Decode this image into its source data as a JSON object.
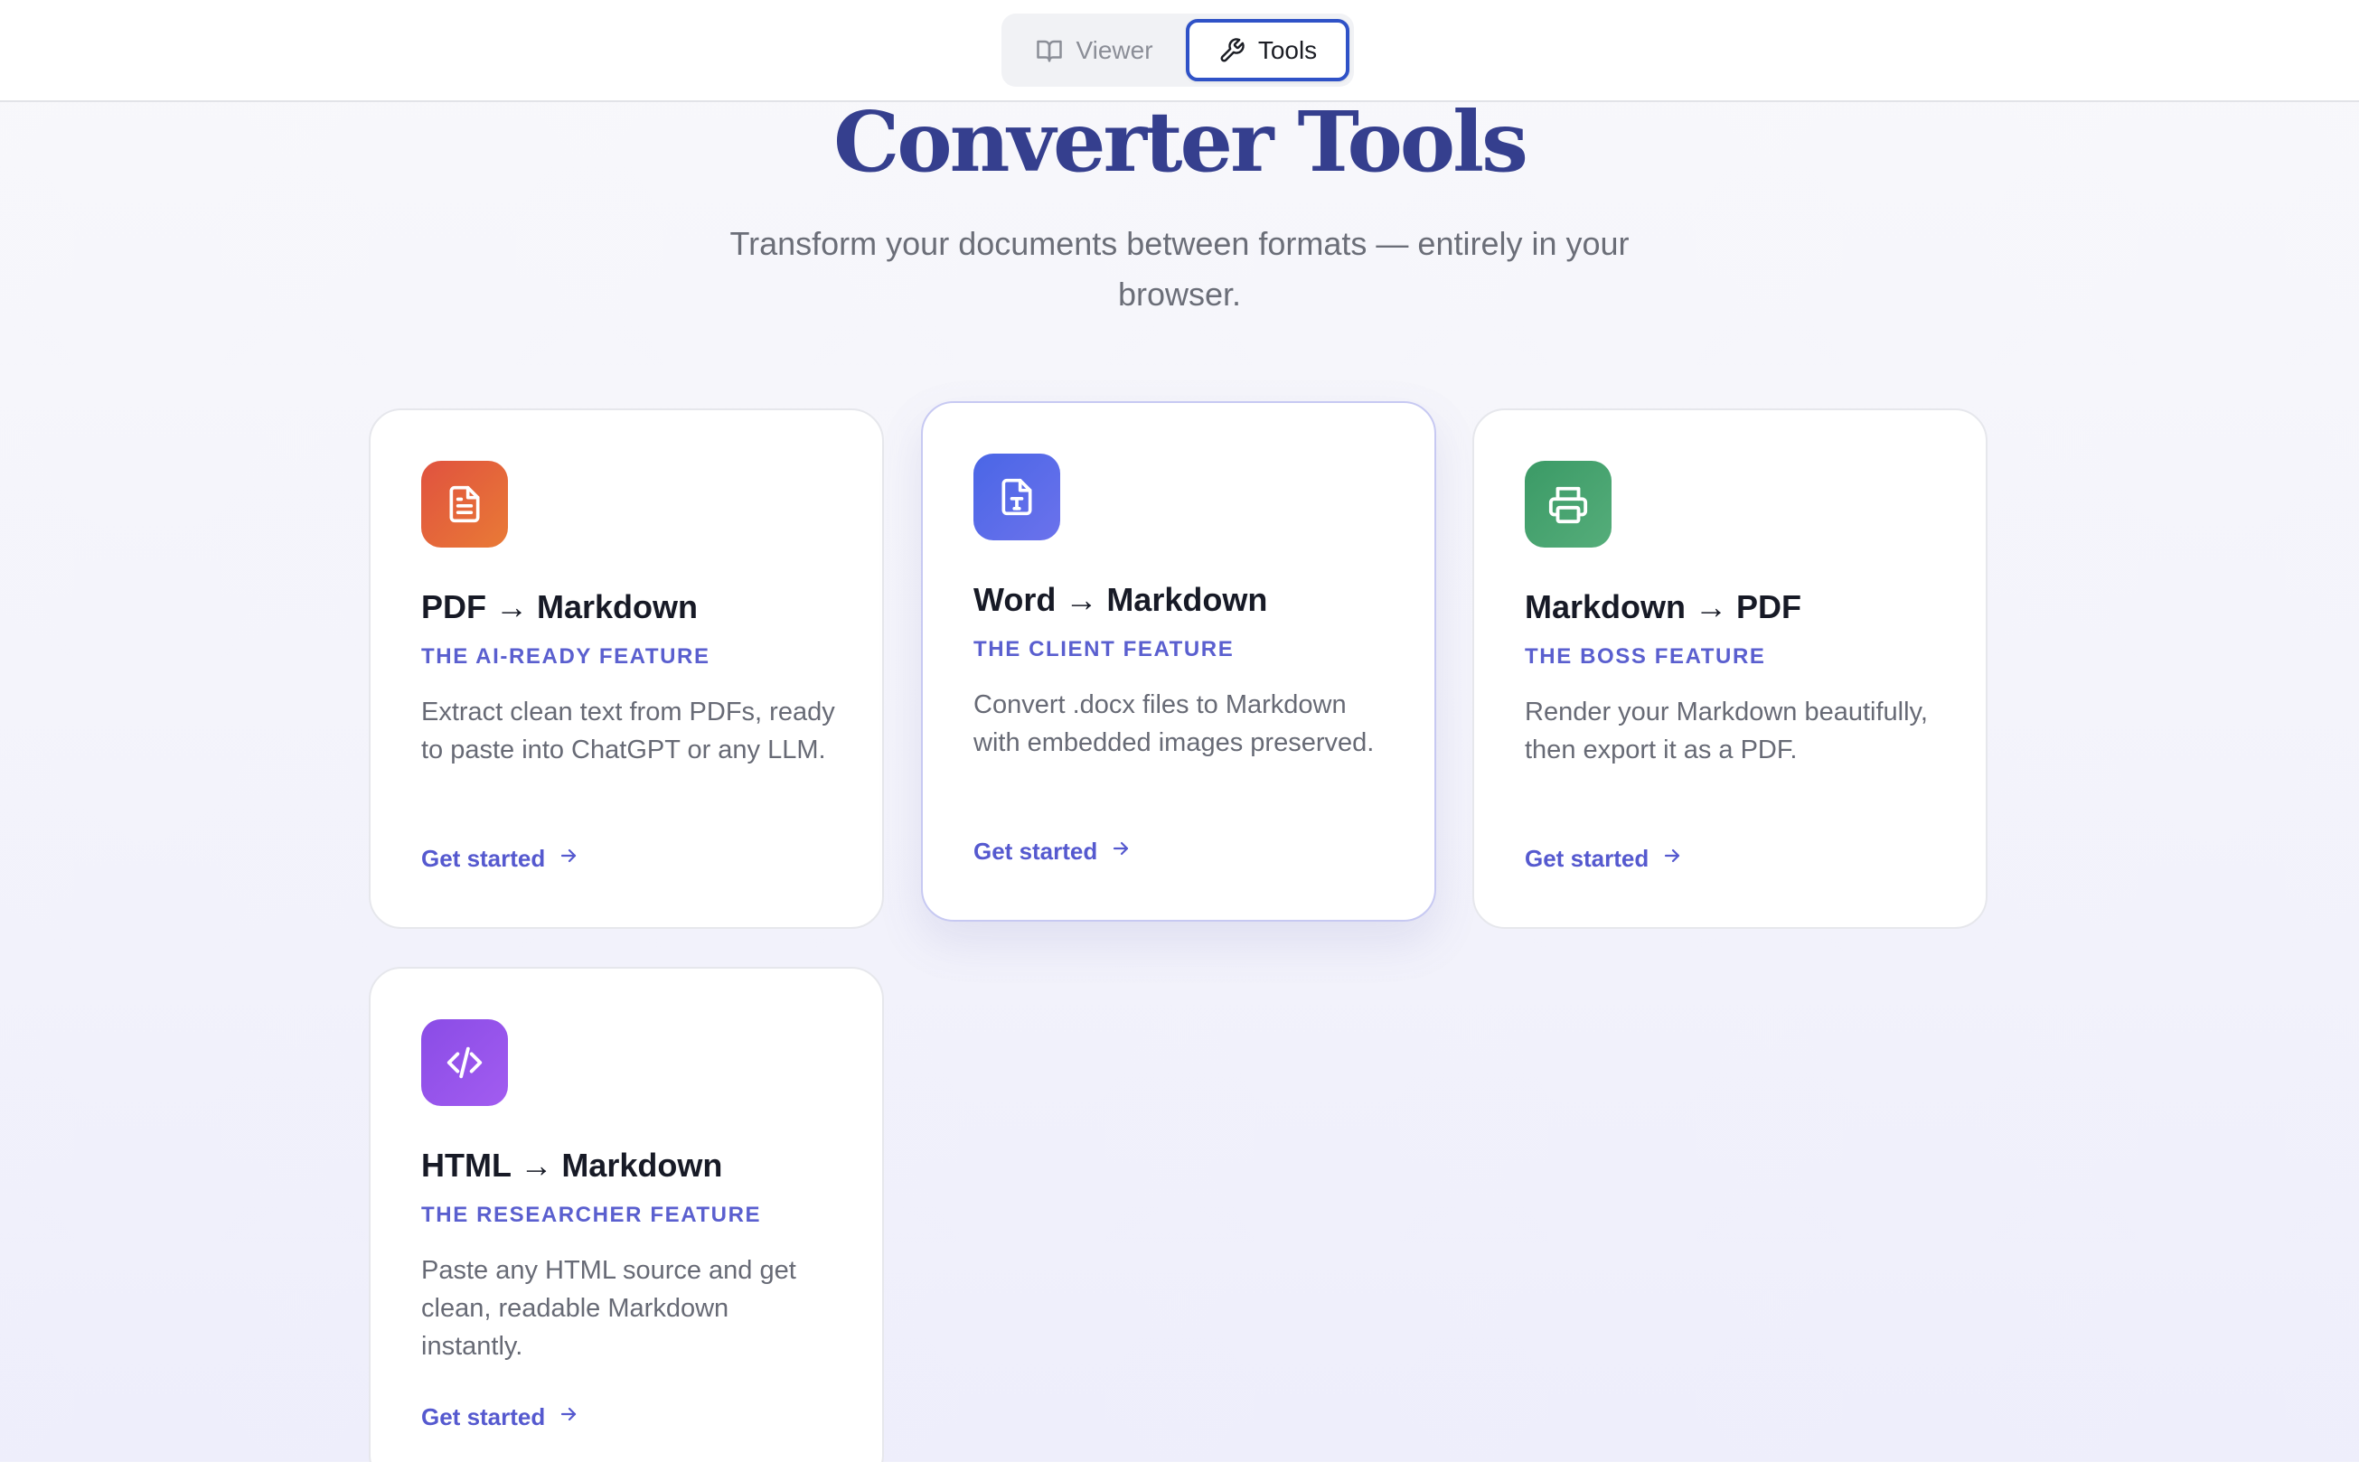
{
  "nav": {
    "viewer_label": "Viewer",
    "tools_label": "Tools",
    "active_tab": "Tools"
  },
  "header": {
    "title": "Converter Tools",
    "subtitle": "Transform your documents between formats — entirely in your browser."
  },
  "cards": [
    {
      "title": "PDF → Markdown",
      "tag": "THE AI-READY FEATURE",
      "description": "Extract clean text from PDFs, ready to paste into ChatGPT or any LLM.",
      "link": "Get started",
      "icon": "file-text-icon",
      "colors": [
        "#e0523f",
        "#e97a36"
      ]
    },
    {
      "title": "Word → Markdown",
      "tag": "THE CLIENT FEATURE",
      "description": "Convert .docx files to Markdown with embedded images preserved.",
      "link": "Get started",
      "icon": "file-type-icon",
      "colors": [
        "#4a66e6",
        "#6b72ec"
      ]
    },
    {
      "title": "Markdown → PDF",
      "tag": "THE BOSS FEATURE",
      "description": "Render your Markdown beautifully, then export it as a PDF.",
      "link": "Get started",
      "icon": "printer-icon",
      "colors": [
        "#3b9a66",
        "#55ad7a"
      ]
    },
    {
      "title": "HTML → Markdown",
      "tag": "THE RESEARCHER FEATURE",
      "description": "Paste any HTML source and get clean, readable Markdown instantly.",
      "link": "Get started",
      "icon": "code-icon",
      "colors": [
        "#8a4ce6",
        "#a25cf0"
      ]
    }
  ],
  "theme": {
    "accent": "#5559cf",
    "title_color": "#353f8e",
    "active_tab_border": "#2f52c7"
  }
}
